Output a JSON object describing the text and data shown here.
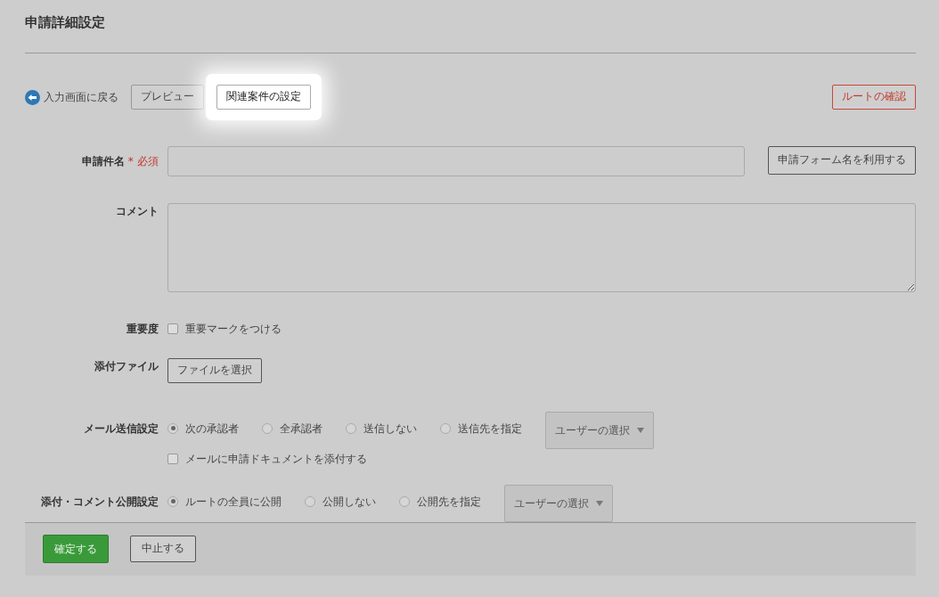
{
  "page_title": "申請詳細設定",
  "toolbar": {
    "back_link": "入力画面に戻る",
    "buttons": [
      {
        "label": "プレビュー",
        "kind": "plain"
      },
      {
        "label": "関連案件の設定",
        "kind": "highlighted"
      }
    ],
    "route_button": "ルートの確認"
  },
  "title_field": {
    "label": "申請件名",
    "required_mark": "*",
    "required_text": "必須",
    "button": "申請フォーム名を利用する"
  },
  "comment_field": {
    "label": "コメント"
  },
  "importance": {
    "label": "重要度",
    "checkbox": {
      "label": "重要マークをつける",
      "checked": false
    }
  },
  "attachment": {
    "label": "添付ファイル",
    "button": "ファイルを選択"
  },
  "mail_settings": {
    "label": "メール送信設定",
    "options": [
      {
        "label": "次の承認者",
        "selected": true
      },
      {
        "label": "全承認者",
        "selected": false
      },
      {
        "label": "送信しない",
        "selected": false
      },
      {
        "label": "送信先を指定",
        "selected": false
      }
    ],
    "user_select": "ユーザーの選択",
    "attach_checkbox": {
      "label": "メールに申請ドキュメントを添付する",
      "checked": false
    }
  },
  "publish_settings": {
    "label": "添付・コメント公開設定",
    "options": [
      {
        "label": "ルートの全員に公開",
        "selected": true
      },
      {
        "label": "公開しない",
        "selected": false
      },
      {
        "label": "公開先を指定",
        "selected": false
      }
    ],
    "user_select": "ユーザーの選択"
  },
  "footer": {
    "buttons": [
      {
        "label": "確定する",
        "kind": "primary"
      },
      {
        "label": "中止する",
        "kind": "secondary"
      }
    ]
  }
}
